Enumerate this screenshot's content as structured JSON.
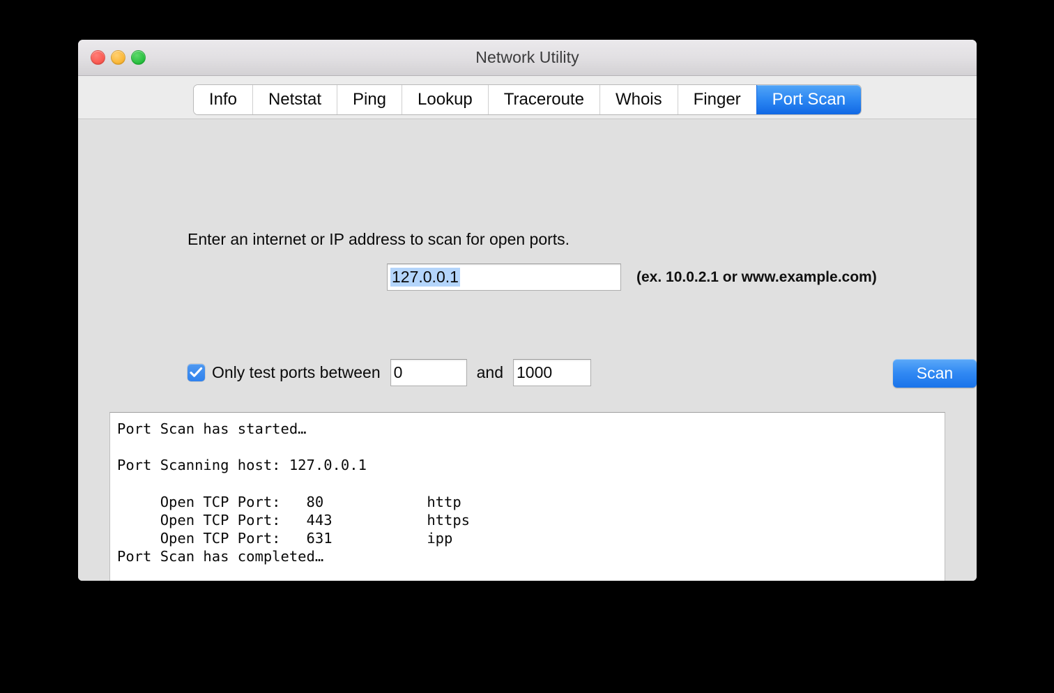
{
  "window": {
    "title": "Network Utility",
    "traffic_lights": [
      {
        "name": "close",
        "color": "#F9544C"
      },
      {
        "name": "minimize",
        "color": "#F9B32E"
      },
      {
        "name": "zoom",
        "color": "#22BC3A"
      }
    ]
  },
  "tabs": [
    {
      "label": "Info",
      "active": false
    },
    {
      "label": "Netstat",
      "active": false
    },
    {
      "label": "Ping",
      "active": false
    },
    {
      "label": "Lookup",
      "active": false
    },
    {
      "label": "Traceroute",
      "active": false
    },
    {
      "label": "Whois",
      "active": false
    },
    {
      "label": "Finger",
      "active": false
    },
    {
      "label": "Port Scan",
      "active": true
    }
  ],
  "main": {
    "prompt": "Enter an internet or IP address to scan for open ports.",
    "host_field": {
      "value": "127.0.0.1",
      "placeholder": "",
      "selected": true,
      "selection_color": "#B4D5FB"
    },
    "host_hint": "(ex. 10.0.2.1 or www.example.com)",
    "port_range": {
      "checkbox_checked": true,
      "checkbox_color": "#3B8BEC",
      "label": "Only test ports between",
      "from_value": "0",
      "and_label": "and",
      "to_value": "1000"
    },
    "scan_button": {
      "label": "Scan",
      "color": "#3189F3"
    }
  },
  "output": {
    "lines": [
      "Port Scan has started…",
      "",
      "Port Scanning host: 127.0.0.1",
      "",
      "     Open TCP Port:   80            http",
      "     Open TCP Port:   443           https",
      "     Open TCP Port:   631           ipp",
      "Port Scan has completed…"
    ],
    "text": "Port Scan has started…\n\nPort Scanning host: 127.0.0.1\n\n     Open TCP Port:   80            http\n     Open TCP Port:   443           https\n     Open TCP Port:   631           ipp\nPort Scan has completed…",
    "scan_results": [
      {
        "protocol": "TCP",
        "port": "80",
        "service": "http"
      },
      {
        "protocol": "TCP",
        "port": "443",
        "service": "https"
      },
      {
        "protocol": "TCP",
        "port": "631",
        "service": "ipp"
      }
    ]
  }
}
